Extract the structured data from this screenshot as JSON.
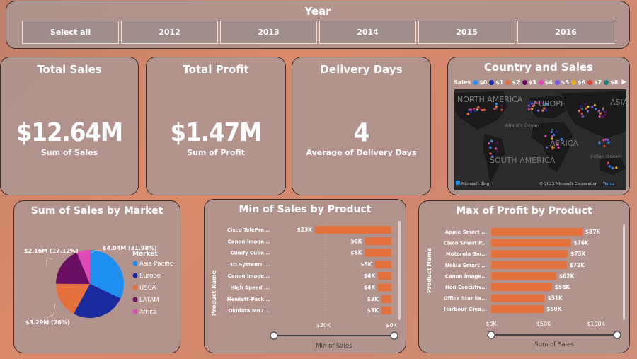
{
  "year_slicer": {
    "title": "Year",
    "options": [
      "Select all",
      "2012",
      "2013",
      "2014",
      "2015",
      "2016"
    ]
  },
  "kpis": {
    "sales": {
      "title": "Total Sales",
      "value": "$12.64M",
      "label": "Sum of Sales"
    },
    "profit": {
      "title": "Total Profit",
      "value": "$1.47M",
      "label": "Sum of Profit"
    },
    "delivery": {
      "title": "Delivery Days",
      "value": "4",
      "label": "Average of Delivery Days"
    }
  },
  "map": {
    "title": "Country and Sales",
    "legend_label": "Sales",
    "legend": [
      {
        "label": "$0",
        "color": "#2d8ef0"
      },
      {
        "label": "$1",
        "color": "#1c2aa8"
      },
      {
        "label": "$2",
        "color": "#e5703c"
      },
      {
        "label": "$3",
        "color": "#6b0f63"
      },
      {
        "label": "$4",
        "color": "#e048b6"
      },
      {
        "label": "$5",
        "color": "#7a5fe0"
      },
      {
        "label": "$6",
        "color": "#e6b222"
      },
      {
        "label": "$7",
        "color": "#d9443b"
      },
      {
        "label": "$8",
        "color": "#1a7f75"
      }
    ],
    "region_labels": [
      "NORTH AMERICA",
      "EUROPE",
      "ASIA",
      "SOUTH AMERICA",
      "AFRICA",
      "Atlantic Ocean",
      "Indian Ocean"
    ],
    "attribution": "Microsoft Bing",
    "copyright": "© 2023 Microsoft Corporation",
    "terms": "Terms"
  },
  "pie": {
    "title": "Sum of Sales by Market",
    "legend_title": "Market",
    "labels": [
      "$4.04M (31.98%)",
      "$2.16M (17.12%)",
      "$3.29M (26%)"
    ]
  },
  "min_sales": {
    "title": "Min of Sales by Product",
    "y_axis": "Product Name",
    "x_axis": "Min of Sales",
    "ticks": [
      "$20K",
      "$0K"
    ]
  },
  "max_profit": {
    "title": "Max of Profit by Product",
    "y_axis": "Product Name",
    "x_axis": "Sum of Sales",
    "ticks": [
      "$0K",
      "$50K",
      "$100K"
    ]
  },
  "chart_data": [
    {
      "type": "pie",
      "title": "Sum of Sales by Market",
      "categories": [
        "Asia Pacific",
        "Europe",
        "USCA",
        "LATAM",
        "Africa"
      ],
      "values": [
        4.04,
        3.29,
        2.16,
        2.36,
        0.79
      ],
      "colors": [
        "#1f8ef1",
        "#1b2a9e",
        "#e4703b",
        "#6b0f63",
        "#df4bb7"
      ],
      "legend": "right"
    },
    {
      "type": "bar",
      "title": "Min of Sales by Product",
      "categories": [
        "Cisco TelePre...",
        "Canon image...",
        "Cubify Cube...",
        "3D Systems ...",
        "Canon image...",
        "High Speed ...",
        "Hewlett-Pack...",
        "Okidata MB7..."
      ],
      "values": [
        23,
        8,
        8,
        5,
        4,
        4,
        3,
        3
      ],
      "value_labels": [
        "$23K",
        "$8K",
        "$8K",
        "$5K",
        "$4K",
        "$4K",
        "$3K",
        "$3K"
      ],
      "xlabel": "Min of Sales",
      "ylabel": "Product Name",
      "xlim": [
        0,
        23
      ],
      "orientation": "horizontal-reversed",
      "color": "#e4703b"
    },
    {
      "type": "bar",
      "title": "Max of Profit by Product",
      "categories": [
        "Apple Smart ...",
        "Cisco Smart P...",
        "Motorola Sm...",
        "Nokia Smart ...",
        "Canon image...",
        "Hon Executiv...",
        "Office Star Ex...",
        "Harbour Crea..."
      ],
      "values": [
        87,
        76,
        73,
        72,
        62,
        58,
        51,
        50
      ],
      "value_labels": [
        "$87K",
        "$76K",
        "$73K",
        "$72K",
        "$62K",
        "$58K",
        "$51K",
        "$50K"
      ],
      "xlabel": "Sum of Sales",
      "ylabel": "Product Name",
      "xlim": [
        0,
        100
      ],
      "orientation": "horizontal",
      "color": "#e4703b"
    }
  ]
}
